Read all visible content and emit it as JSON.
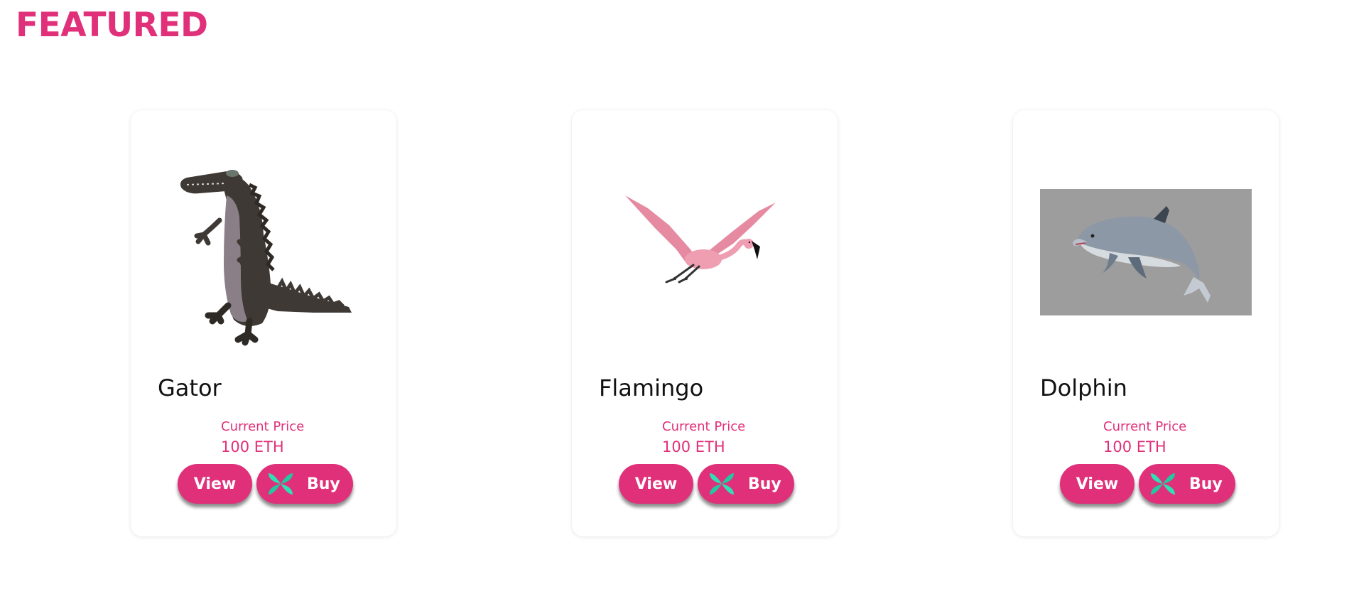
{
  "section": {
    "title": "FEATURED"
  },
  "cards": [
    {
      "name": "Gator",
      "price_label": "Current Price",
      "price_value": "100 ETH",
      "view_label": "View",
      "buy_label": "Buy",
      "image": "alligator-3d-model"
    },
    {
      "name": "Flamingo",
      "price_label": "Current Price",
      "price_value": "100 ETH",
      "view_label": "View",
      "buy_label": "Buy",
      "image": "flamingo-3d-model"
    },
    {
      "name": "Dolphin",
      "price_label": "Current Price",
      "price_value": "100 ETH",
      "view_label": "View",
      "buy_label": "Buy",
      "image": "dolphin-3d-model"
    }
  ],
  "colors": {
    "accent": "#e0307a",
    "buy_icon_primary": "#2ee0b4",
    "dolphin_bg": "#9d9d9d"
  },
  "icons": {
    "buy": "four-petal-flower-icon"
  }
}
